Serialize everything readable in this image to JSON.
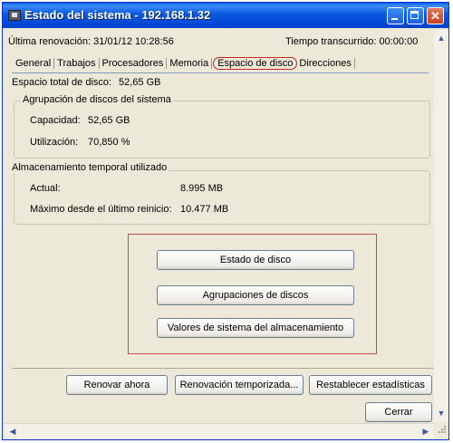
{
  "window": {
    "title": "Estado del sistema - 192.168.1.32",
    "minimize_glyph": "",
    "maximize_glyph": "",
    "close_glyph": "✕",
    "title_bg": "#0a58e0"
  },
  "status": {
    "last_refresh": "Última renovación: 31/01/12 10:28:56",
    "elapsed": "Tiempo transcurrido: 00:00:00"
  },
  "tabs": [
    {
      "label": "General"
    },
    {
      "label": "Trabajos"
    },
    {
      "label": "Procesadores"
    },
    {
      "label": "Memoria"
    },
    {
      "label": "Espacio de disco",
      "active": true
    },
    {
      "label": "Direcciones"
    }
  ],
  "disk": {
    "total_label": "Espacio total de disco:",
    "total_value": "52,65 GB",
    "pool_group": {
      "title": "Agrupación de discos del sistema",
      "capacity_label": "Capacidad:",
      "capacity_value": "52,65 GB",
      "usage_label": "Utilización:",
      "usage_value": "70,850 %"
    },
    "temp_group": {
      "title": "Almacenamiento temporal utilizado",
      "current_label": "Actual:",
      "current_value": "8.995 MB",
      "max_label": "Máximo desde el último reinicio:",
      "max_value": "10.477 MB"
    }
  },
  "actions": {
    "disk_status": "Estado de disco",
    "disk_pools": "Agrupaciones de discos",
    "storage_values": "Valores de sistema del almacenamiento"
  },
  "footer": {
    "refresh_now": "Renovar ahora",
    "timed_refresh": "Renovación temporizada...",
    "reset_stats": "Restablecer estadísticas",
    "close": "Cerrar"
  },
  "scroll": {
    "up": "▲",
    "down": "▼",
    "left": "◀",
    "right": "▶"
  },
  "colors": {
    "window_bg": "#ece9d8",
    "highlight_border": "#cc4a4a"
  }
}
